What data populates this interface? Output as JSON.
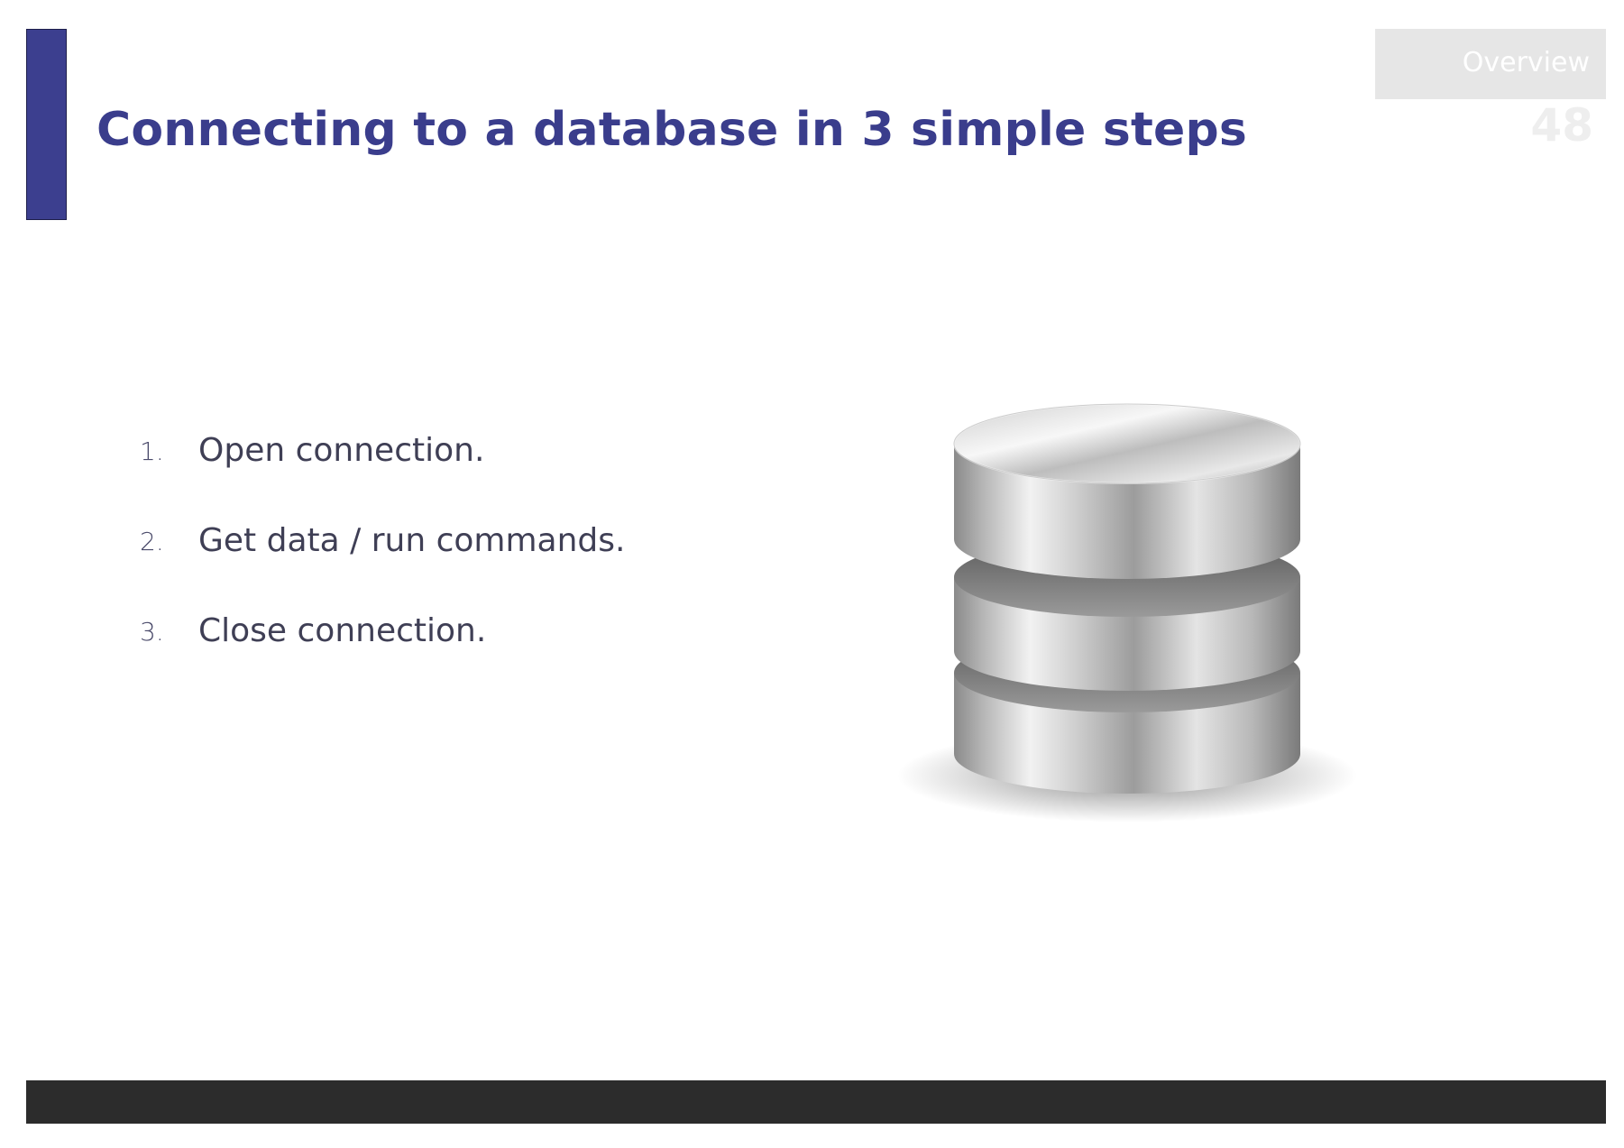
{
  "slide": {
    "title": "Connecting to a database in 3 simple steps",
    "section_label": "Overview",
    "page_number": "48"
  },
  "steps": [
    {
      "number": "1.",
      "text": "Open connection."
    },
    {
      "number": "2.",
      "text": "Get data / run commands."
    },
    {
      "number": "3.",
      "text": "Close connection."
    }
  ],
  "illustration": {
    "icon": "database-icon"
  },
  "colors": {
    "accent": "#3c3f8f",
    "title": "#3a3d8c",
    "footer": "#2c2c2c",
    "tab": "#e6e6e6"
  }
}
